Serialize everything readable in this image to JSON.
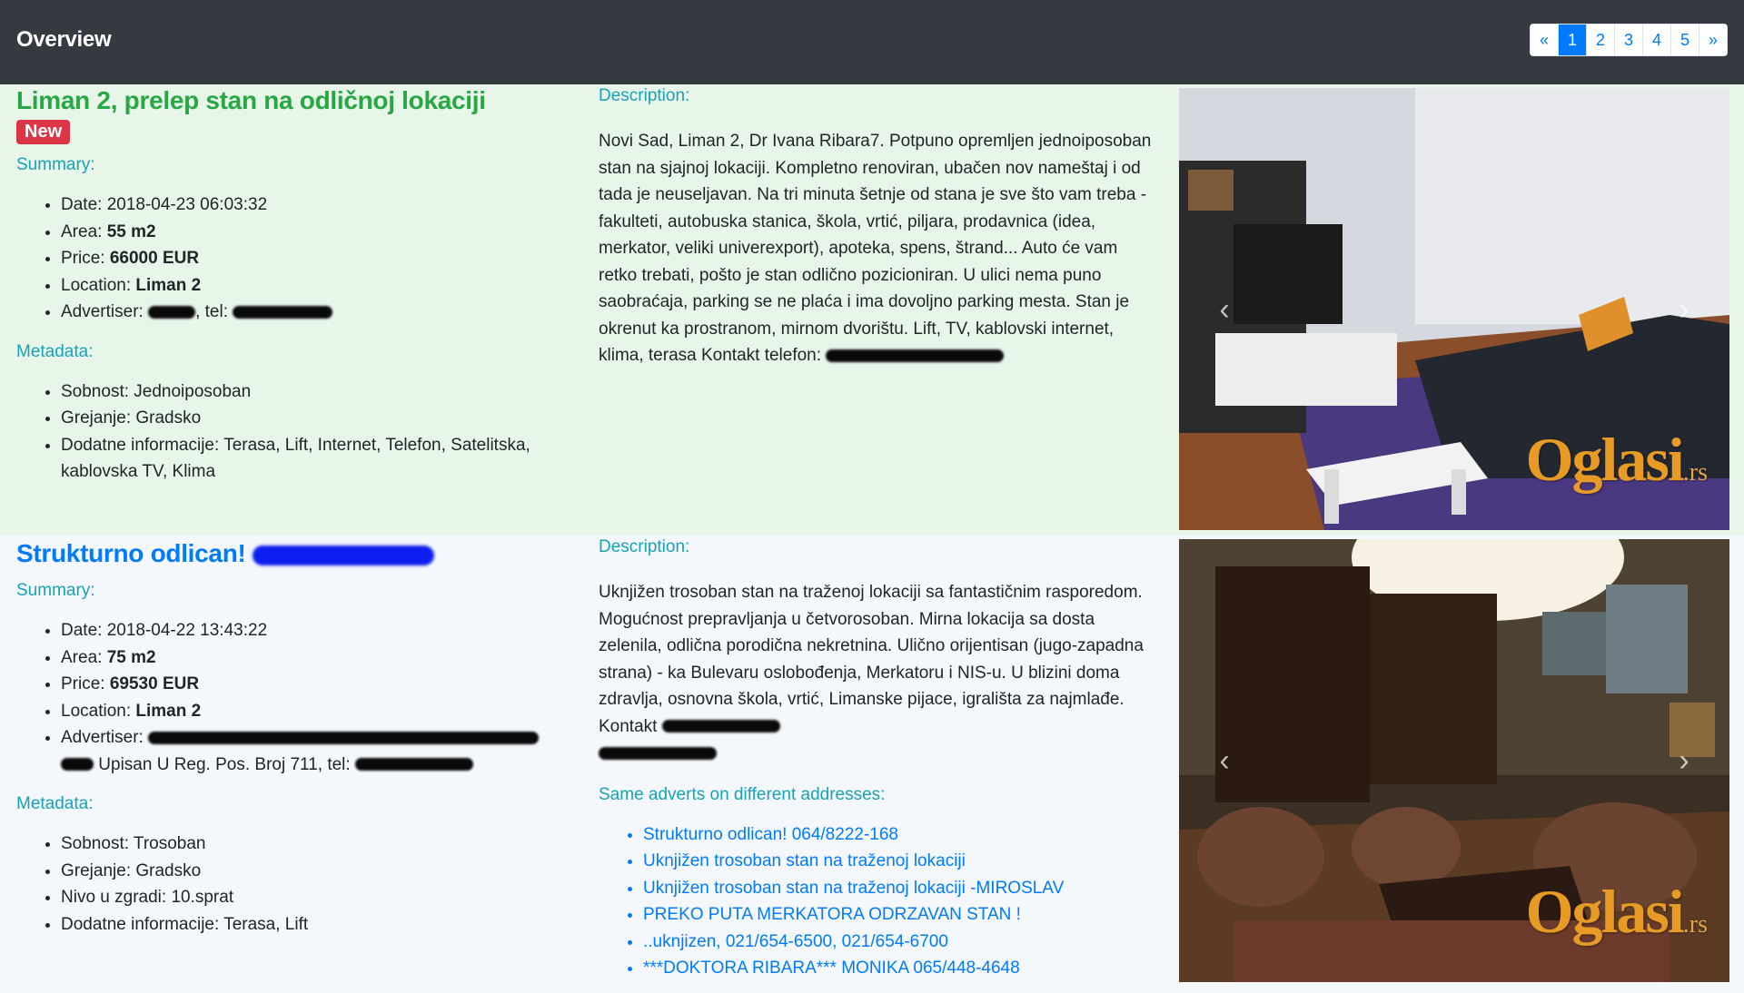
{
  "navbar": {
    "brand": "Overview",
    "pagination": [
      "«",
      "1",
      "2",
      "3",
      "4",
      "5",
      "»"
    ],
    "active_page": "1",
    "bg_color": "#343a40",
    "accent": "#007bff"
  },
  "listings": [
    {
      "title": "Liman 2, prelep stan na odličnoj lokaciji",
      "badge": "New",
      "summary_label": "Summary:",
      "summary": {
        "date_label": "Date:",
        "date": "2018-04-23 06:03:32",
        "area_label": "Area:",
        "area": "55 m2",
        "price_label": "Price:",
        "price": "66000 EUR",
        "location_label": "Location:",
        "location": "Liman 2",
        "advertiser_label": "Advertiser:",
        "tel_label": ", tel:"
      },
      "metadata_label": "Metadata:",
      "metadata": [
        "Sobnost: Jednoiposoban",
        "Grejanje: Gradsko",
        "Dodatne informacije: Terasa, Lift, Internet, Telefon, Satelitska, kablovska TV, Klima"
      ],
      "description_label": "Description:",
      "description": "Novi Sad, Liman 2, Dr Ivana Ribara7. Potpuno opremljen jednoiposoban stan na sjajnoj lokaciji. Kompletno renoviran, ubačen nov nameštaj i od tada je neuseljavan. Na tri minuta šetnje od stana je sve što vam treba - fakulteti, autobuska stanica, škola, vrtić, piljara, prodavnica (idea, merkator, veliki univerexport), apoteka, spens, štrand... Auto će vam retko trebati, pošto je stan odlično pozicioniran. U ulici nema puno saobraćaja, parking se ne plaća i ima dovoljno parking mesta. Stan je okrenut ka prostranom, mirnom dvorištu. Lift, TV, kablovski internet, klima, terasa Kontakt telefon:",
      "watermark": "Oglasi",
      "watermark_suffix": ".rs"
    },
    {
      "title": "Strukturno odlican!",
      "summary_label": "Summary:",
      "summary": {
        "date_label": "Date:",
        "date": "2018-04-22 13:43:22",
        "area_label": "Area:",
        "area": "75 m2",
        "price_label": "Price:",
        "price": "69530 EUR",
        "location_label": "Location:",
        "location": "Liman 2",
        "advertiser_label": "Advertiser:",
        "advertiser_extra": "Upisan U Reg. Pos. Broj 711, tel:"
      },
      "metadata_label": "Metadata:",
      "metadata": [
        "Sobnost: Trosoban",
        "Grejanje: Gradsko",
        "Nivo u zgradi: 10.sprat",
        "Dodatne informacije: Terasa, Lift"
      ],
      "description_label": "Description:",
      "description": "Uknjižen trosoban stan na traženoj lokaciji sa fantastičnim rasporedom. Mogućnost prepravljanja u četvorosoban. Mirna lokacija sa dosta zelenila, odlična porodična nekretnina. Ulično orijentisan (jugo-zapadna strana) - ka Bulevaru oslobođenja, Merkatoru i NIS-u. U blizini doma zdravlja, osnovna škola, vrtić, Limanske pijace, igrališta za najmlađe. Kontakt",
      "same_label": "Same adverts on different addresses:",
      "same_links": [
        "Strukturno odlican! 064/8222-168",
        "Uknjižen trosoban stan na traženoj lokaciji",
        "Uknjižen trosoban stan na traženoj lokaciji -MIROSLAV",
        "PREKO PUTA MERKATORA ODRZAVAN STAN !",
        "..uknjizen, 021/654-6500, 021/654-6700",
        "***DOKTORA RIBARA*** MONIKA 065/448-4648"
      ],
      "watermark": "Oglasi",
      "watermark_suffix": ".rs"
    }
  ]
}
